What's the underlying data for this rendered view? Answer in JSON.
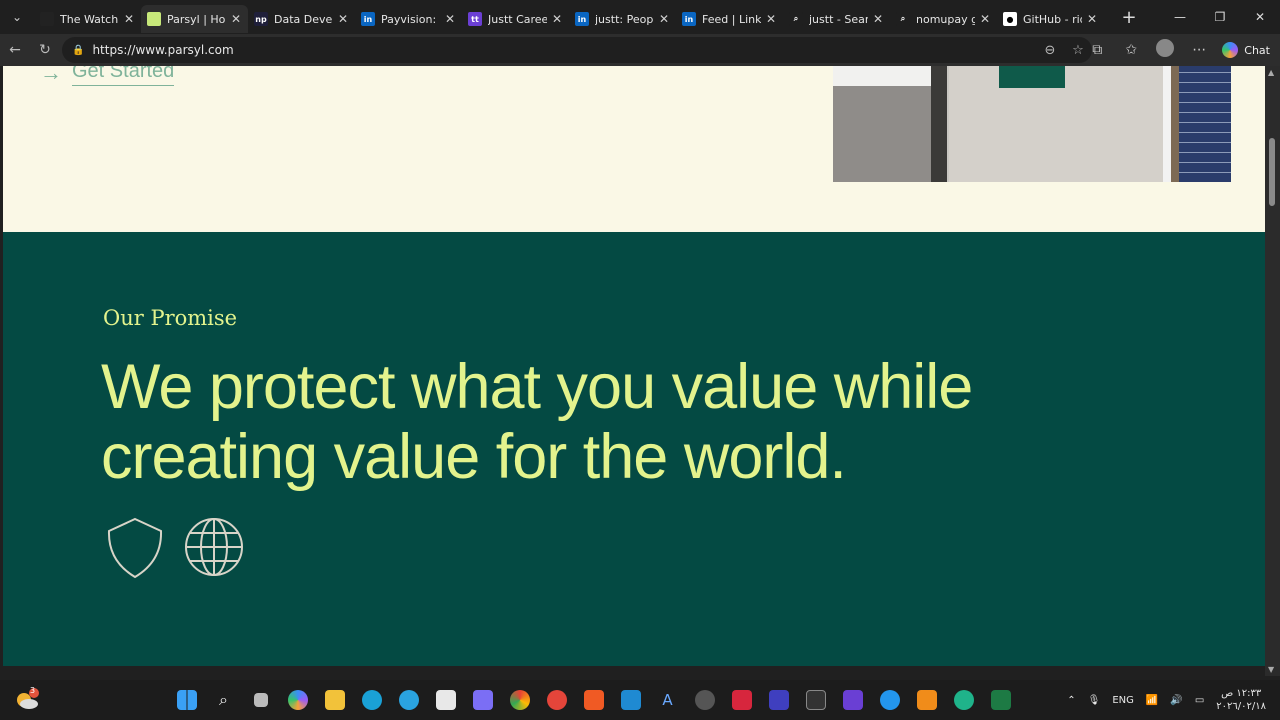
{
  "browser": {
    "tabs": [
      {
        "title": "The Watchlist",
        "fav_color": "#222222",
        "fav_glyph": ""
      },
      {
        "title": "Parsyl | Home",
        "fav_color": "#c7e87a",
        "fav_glyph": "",
        "active": true
      },
      {
        "title": "Data Develop",
        "fav_color": "#1f1f3a",
        "fav_glyph": "np"
      },
      {
        "title": "Payvision: Pe",
        "fav_color": "#0a66c2",
        "fav_glyph": "in"
      },
      {
        "title": "Justt Career C",
        "fav_color": "#6b3fd4",
        "fav_glyph": "tt"
      },
      {
        "title": "justt: People",
        "fav_color": "#0a66c2",
        "fav_glyph": "in"
      },
      {
        "title": "Feed | Linked",
        "fav_color": "#0a66c2",
        "fav_glyph": "in"
      },
      {
        "title": "justt - Search",
        "fav_color": "#1f1f1f",
        "fav_glyph": "⌕"
      },
      {
        "title": "nomupay gith",
        "fav_color": "#1f1f1f",
        "fav_glyph": "⌕"
      },
      {
        "title": "GitHub - ridw",
        "fav_color": "#ffffff",
        "fav_glyph": "●"
      }
    ],
    "url": "https://www.parsyl.com",
    "chat_label": "Chat"
  },
  "page": {
    "cta_label": "Get Started",
    "kicker": "Our Promise",
    "headline": "We protect what you value while creating value for the world.",
    "colors": {
      "cream": "#faf8e6",
      "green": "#044a43",
      "accent": "#e3f38d"
    },
    "icons": [
      "shield-icon",
      "globe-icon"
    ]
  },
  "taskbar": {
    "notification_badge": "3",
    "language": "ENG",
    "time": "١٢:٣٣ ص",
    "date": "٢٠٢٦/٠٢/١٨"
  }
}
